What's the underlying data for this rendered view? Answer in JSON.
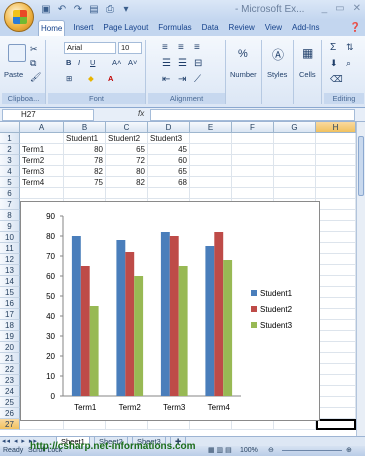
{
  "app": {
    "title": "- Microsoft Ex..."
  },
  "ribbon": {
    "tabs": [
      "Home",
      "Insert",
      "Page Layout",
      "Formulas",
      "Data",
      "Review",
      "View",
      "Add-Ins"
    ],
    "groups": {
      "clipboard": "Clipboa...",
      "font": "Font",
      "alignment": "Alignment",
      "number": "Number",
      "styles": "Styles",
      "cells": "Cells",
      "editing": "Editing"
    },
    "paste_label": "Paste",
    "font_name": "Arial",
    "font_size": "10",
    "percent": "%"
  },
  "formula_bar": {
    "name_box": "H27",
    "fx": "fx",
    "formula": ""
  },
  "sheet": {
    "columns": [
      "A",
      "B",
      "C",
      "D",
      "E",
      "F",
      "G",
      "H"
    ],
    "rows": [
      "1",
      "2",
      "3",
      "4",
      "5",
      "6",
      "7",
      "8",
      "9",
      "10",
      "11",
      "12",
      "13",
      "14",
      "15",
      "16",
      "17",
      "18",
      "19",
      "20",
      "21",
      "22",
      "23",
      "24",
      "25",
      "26",
      "27"
    ],
    "selected_column": "H",
    "selected_row": "27",
    "header_row": [
      "",
      "Student1",
      "Student2",
      "Student3"
    ],
    "data_rows": [
      [
        "Term1",
        "80",
        "65",
        "45"
      ],
      [
        "Term2",
        "78",
        "72",
        "60"
      ],
      [
        "Term3",
        "82",
        "80",
        "65"
      ],
      [
        "Term4",
        "75",
        "82",
        "68"
      ]
    ]
  },
  "chart_data": {
    "type": "bar",
    "categories": [
      "Term1",
      "Term2",
      "Term3",
      "Term4"
    ],
    "series": [
      {
        "name": "Student1",
        "values": [
          80,
          78,
          82,
          75
        ],
        "color": "#4a7ebb"
      },
      {
        "name": "Student2",
        "values": [
          65,
          72,
          80,
          82
        ],
        "color": "#be4b48"
      },
      {
        "name": "Student3",
        "values": [
          45,
          60,
          65,
          68
        ],
        "color": "#98b954"
      }
    ],
    "yticks": [
      "0",
      "10",
      "20",
      "30",
      "40",
      "50",
      "60",
      "70",
      "80",
      "90"
    ],
    "ylim": [
      0,
      90
    ],
    "legend": "right",
    "grid": false
  },
  "sheet_tabs": [
    "Sheet1",
    "Sheet2",
    "Sheet3"
  ],
  "active_sheet": "Sheet1",
  "status": {
    "left": "Ready",
    "scroll_lock": "Scroll Lock",
    "zoom": "100%"
  },
  "watermark": "http://csharp.net-informations.com"
}
